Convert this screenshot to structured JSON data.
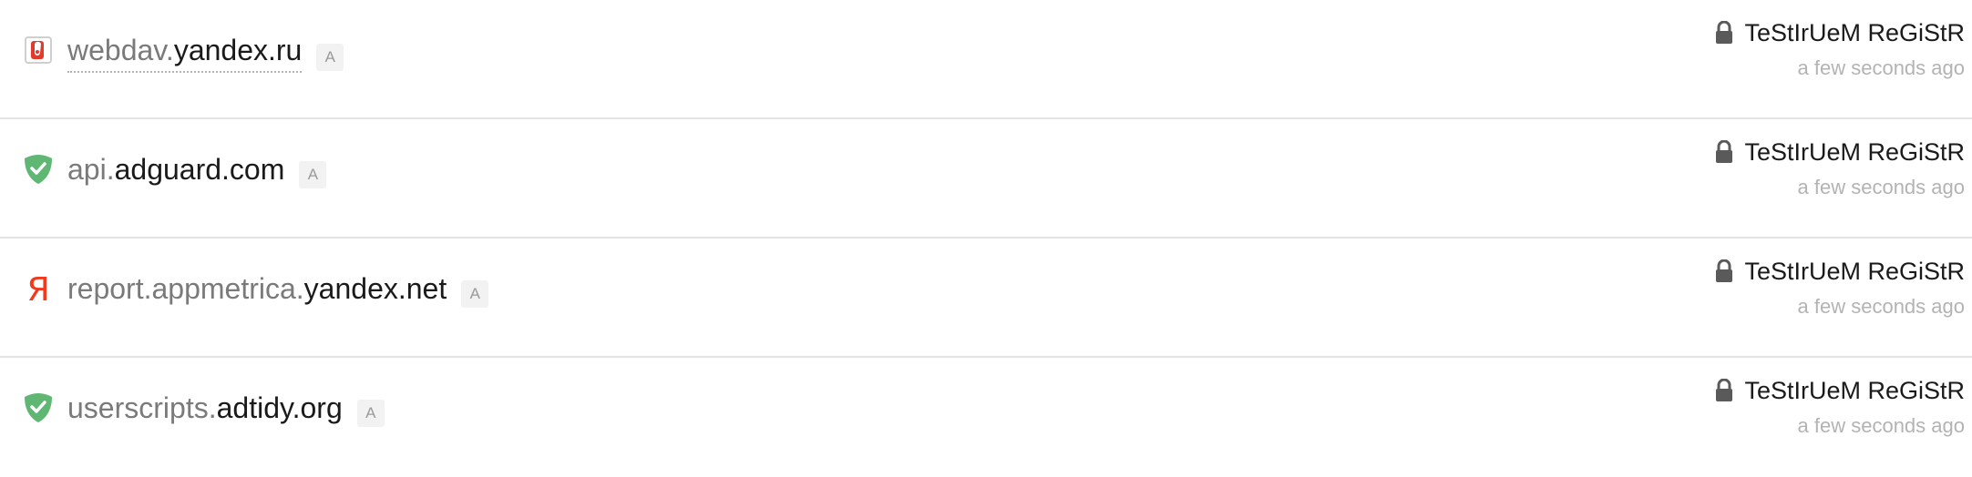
{
  "rows": [
    {
      "favicon": "yandex-disk-icon",
      "subdomain": "webdav.",
      "root_domain": "yandex.ru",
      "badge": "A",
      "account": "TeStIrUeM ReGiStR",
      "time": "a few seconds ago"
    },
    {
      "favicon": "adguard-shield-icon",
      "subdomain": "api.",
      "root_domain": "adguard.com",
      "badge": "A",
      "account": "TeStIrUeM ReGiStR",
      "time": "a few seconds ago"
    },
    {
      "favicon": "yandex-ya-icon",
      "subdomain": "report.appmetrica.",
      "root_domain": "yandex.net",
      "badge": "A",
      "account": "TeStIrUeM ReGiStR",
      "time": "a few seconds ago"
    },
    {
      "favicon": "adguard-shield-icon",
      "subdomain": "userscripts.",
      "root_domain": "adtidy.org",
      "badge": "A",
      "account": "TeStIrUeM ReGiStR",
      "time": "a few seconds ago"
    }
  ],
  "colors": {
    "shield_green": "#5fb773",
    "yandex_red": "#f4381c",
    "lock": "#5a5a5a"
  }
}
